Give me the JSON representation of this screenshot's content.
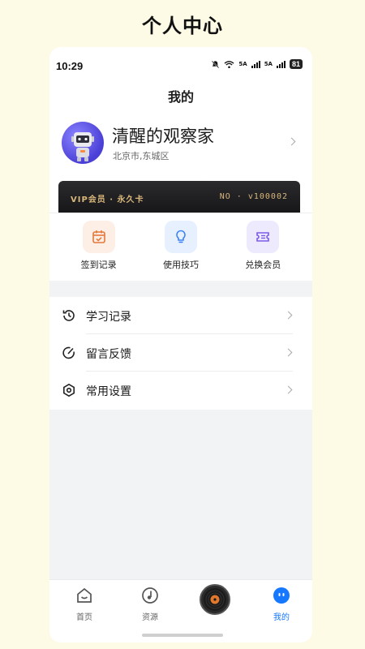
{
  "page": {
    "title": "个人中心"
  },
  "status_bar": {
    "time": "10:29",
    "battery": "81",
    "signal1": "5A",
    "signal2": "5A"
  },
  "header": {
    "title": "我的"
  },
  "profile": {
    "name": "清醒的观察家",
    "location": "北京市,东城区"
  },
  "vip": {
    "left_text": "VIP会员 · 永久卡",
    "right_text": "NO · v100002",
    "accent": "#d9b77a"
  },
  "quick_actions": [
    {
      "label": "签到记录",
      "icon": "calendar-check-icon",
      "bg": "#fdeee6",
      "color": "#e4793b"
    },
    {
      "label": "使用技巧",
      "icon": "lightbulb-icon",
      "bg": "#e7f0fe",
      "color": "#3b82f6"
    },
    {
      "label": "兑换会员",
      "icon": "ticket-icon",
      "bg": "#eeeafd",
      "color": "#7c5ce6"
    }
  ],
  "menu": [
    {
      "label": "学习记录",
      "icon": "history-icon"
    },
    {
      "label": "留言反馈",
      "icon": "feedback-icon"
    },
    {
      "label": "常用设置",
      "icon": "settings-icon"
    }
  ],
  "tabbar": {
    "home": "首页",
    "resources": "资源",
    "mine": "我的",
    "active_color": "#1677ff"
  }
}
